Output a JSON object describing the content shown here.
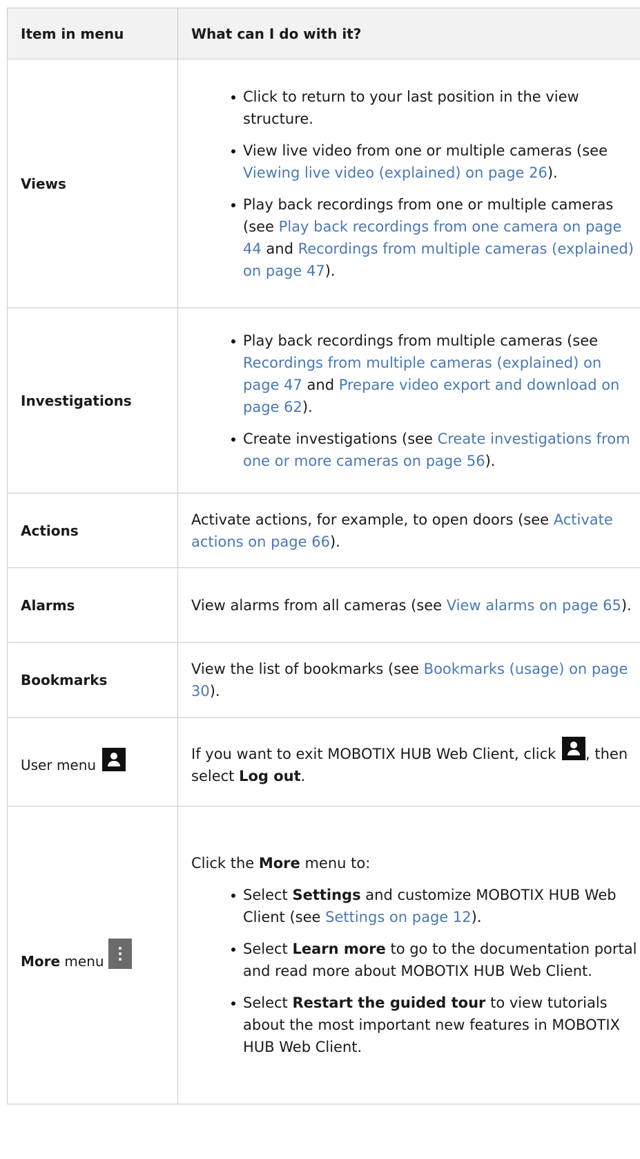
{
  "header": {
    "col1": "Item in menu",
    "col2": "What can I do with it?"
  },
  "views": {
    "label": "Views",
    "b1": "Click to return to your last position in the view structure.",
    "b2_pre": "View live video from one or multiple cameras (see ",
    "b2_link": "Viewing live video (explained) on page 26",
    "b2_post": ").",
    "b3_pre": "Play back recordings from one or multiple cameras (see ",
    "b3_link1": "Play back recordings from one camera on page 44",
    "b3_mid": " and ",
    "b3_link2": "Recordings from multiple cameras (explained) on page 47",
    "b3_post": ")."
  },
  "investigations": {
    "label": "Investigations",
    "b1_pre": "Play back recordings from multiple cameras (see ",
    "b1_link1": "Recordings from multiple cameras (explained) on page 47",
    "b1_mid": " and ",
    "b1_link2": "Prepare video export and download on page 62",
    "b1_post": ").",
    "b2_pre": "Create investigations (see ",
    "b2_link": "Create investigations from one or more cameras on page 56",
    "b2_post": ")."
  },
  "actions": {
    "label": "Actions",
    "pre": "Activate actions, for example, to open doors (see ",
    "link": "Activate actions on page 66",
    "post": ")."
  },
  "alarms": {
    "label": "Alarms",
    "pre": "View alarms from all cameras (see ",
    "link": "View alarms on page 65",
    "post": ")."
  },
  "bookmarks": {
    "label": "Bookmarks",
    "pre": "View the list of bookmarks (see ",
    "link": "Bookmarks (usage) on page 30",
    "post": ")."
  },
  "user_menu": {
    "label": "User menu",
    "icon": "user-icon",
    "pre": "If you want to exit MOBOTIX HUB Web Client, click ",
    "mid": ", then select ",
    "bold": "Log out",
    "post": "."
  },
  "more_menu": {
    "label_bold": "More",
    "label_rest": " menu",
    "icon": "more-vertical-icon",
    "intro_pre": "Click the ",
    "intro_bold": "More",
    "intro_post": " menu to:",
    "b1_pre": "Select ",
    "b1_bold": "Settings",
    "b1_mid": " and customize MOBOTIX HUB Web Client (see ",
    "b1_link": "Settings on page 12",
    "b1_post": ").",
    "b2_pre": "Select ",
    "b2_bold": "Learn more",
    "b2_post": " to go to the documentation portal and read more about MOBOTIX HUB Web Client.",
    "b3_pre": "Select ",
    "b3_bold": "Restart the guided tour",
    "b3_post": " to view tutorials about the most important new features in MOBOTIX HUB Web Client."
  }
}
